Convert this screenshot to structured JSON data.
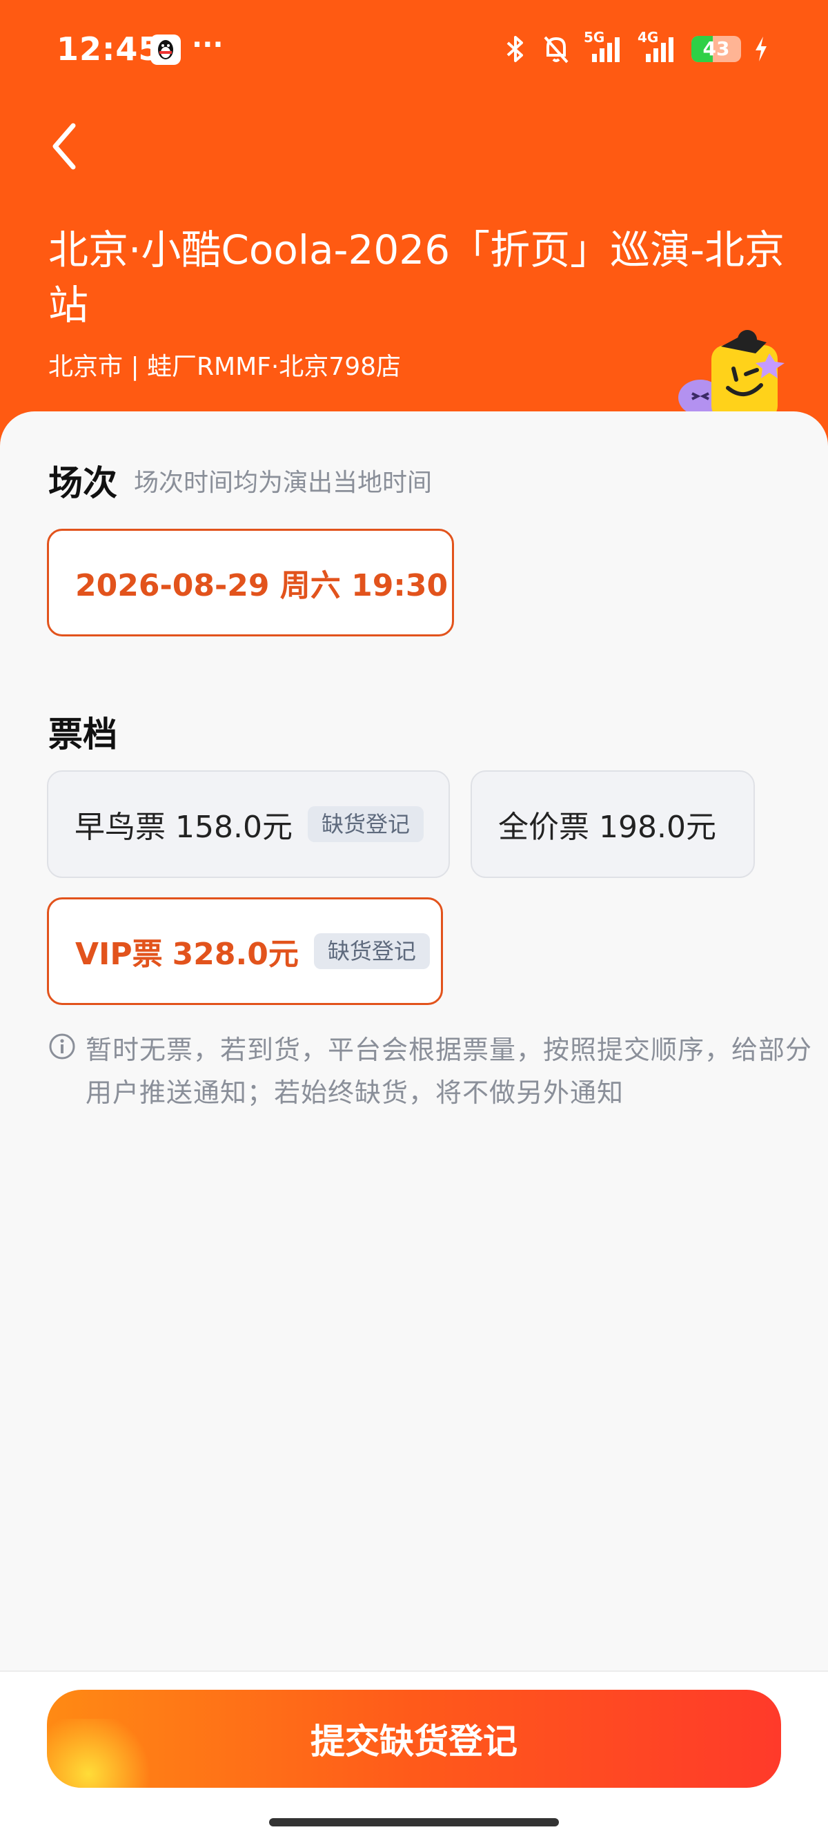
{
  "status_bar": {
    "time": "12:45",
    "battery": 43,
    "network_1": "5G",
    "network_2": "4G",
    "icons": [
      "qq-icon",
      "more-dots-icon",
      "bluetooth-icon",
      "bell-muted-icon",
      "signal-icon",
      "signal-icon",
      "charging-icon"
    ]
  },
  "header": {
    "title": "北京·小酷Coola-2026「折页」巡演-北京站",
    "venue": "北京市 | 蛙厂RMMF·北京798店"
  },
  "session": {
    "title": "场次",
    "hint": "场次时间均为演出当地时间",
    "selected": "2026-08-29 周六 19:30"
  },
  "tickets": {
    "title": "票档",
    "options": [
      {
        "name": "早鸟票",
        "price": "158.0元",
        "tag": "缺货登记",
        "selected": false
      },
      {
        "name": "全价票",
        "price": "198.0元",
        "tag": "",
        "selected": false
      },
      {
        "name": "VIP票",
        "price": "328.0元",
        "tag": "缺货登记",
        "selected": true
      }
    ]
  },
  "notice": "暂时无票，若到货，平台会根据票量，按照提交顺序，给部分用户推送通知；若始终缺货，将不做另外通知",
  "submit_label": "提交缺货登记",
  "colors": {
    "header_bg": "#ff5a12",
    "accent": "#e2531c",
    "tag_bg": "#e4e8ef"
  }
}
